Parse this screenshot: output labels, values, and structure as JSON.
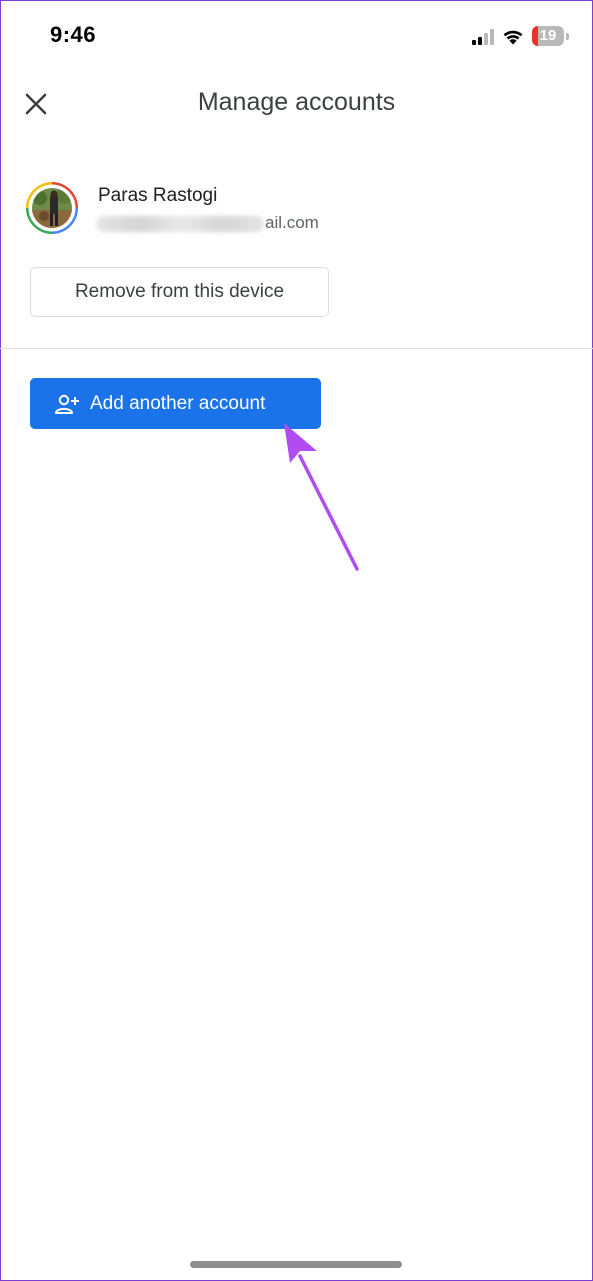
{
  "status_bar": {
    "time": "9:46",
    "battery_level": "19",
    "battery_color": "#e8322c",
    "signal_icon": "cellular-signal-icon",
    "wifi_icon": "wifi-icon"
  },
  "header": {
    "title": "Manage accounts",
    "close_icon": "close-icon"
  },
  "account": {
    "name": "Paras Rastogi",
    "email_visible_suffix": "ail.com",
    "remove_label": "Remove from this device"
  },
  "actions": {
    "add_account_label": "Add another account",
    "add_account_icon": "person-add-icon",
    "accent_color": "#1a73e8"
  },
  "annotation": {
    "arrow_color": "#b14cf3"
  }
}
